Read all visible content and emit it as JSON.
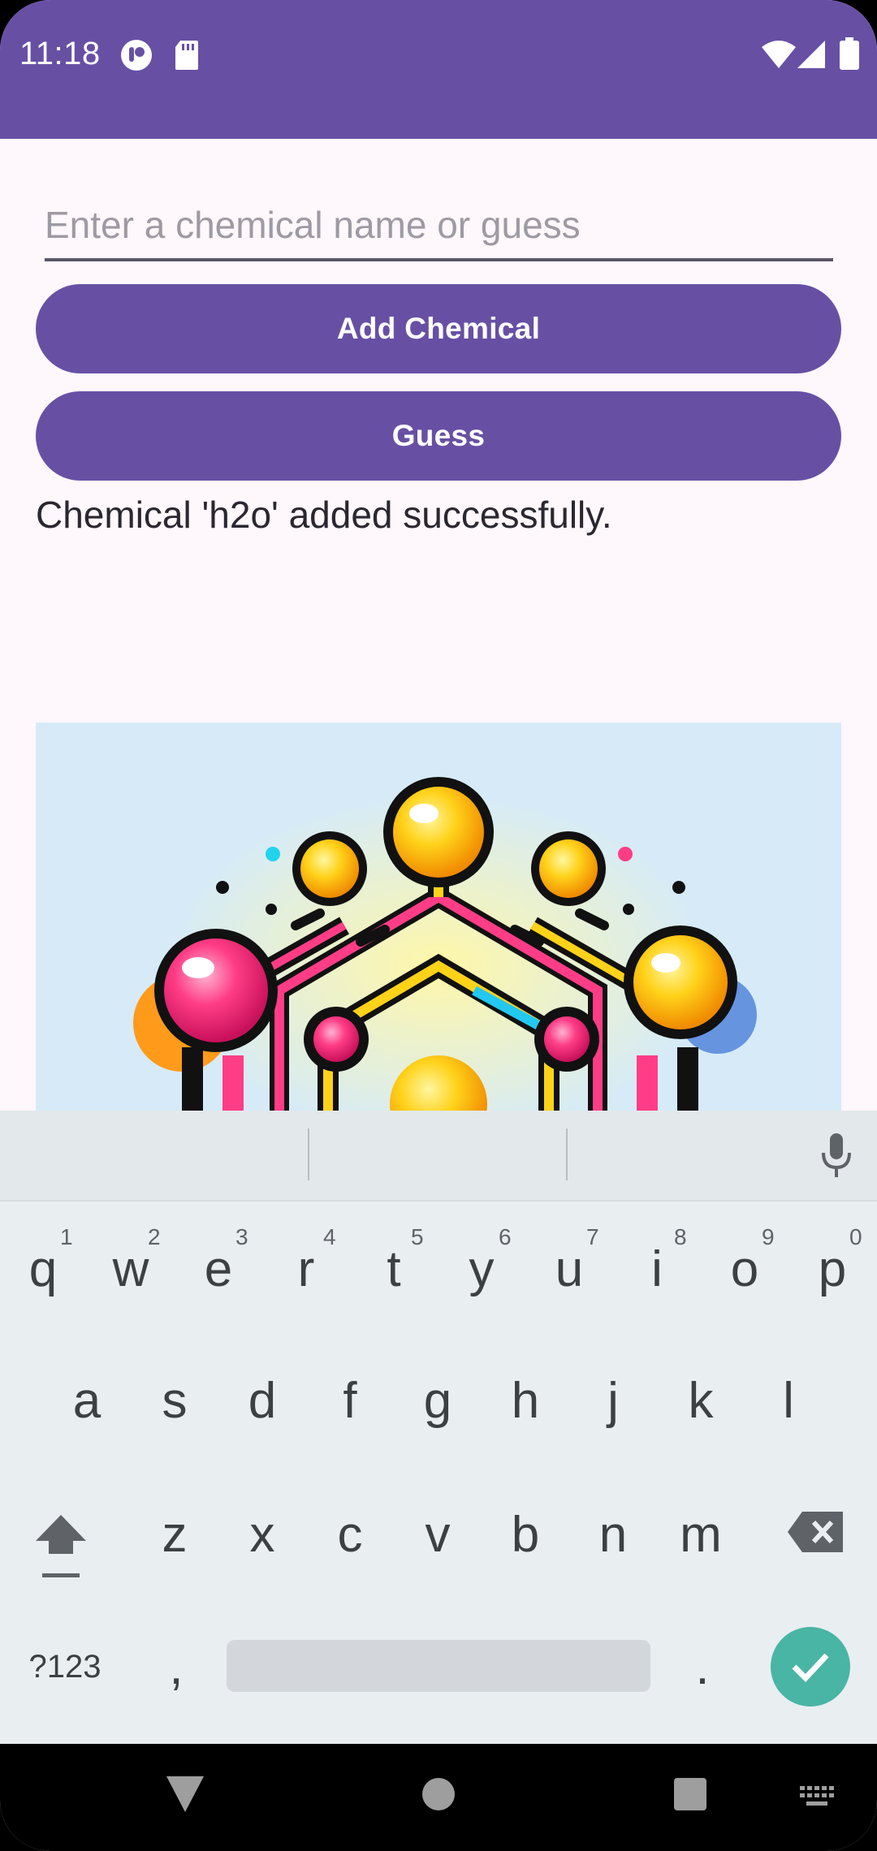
{
  "status_bar": {
    "time": "11:18"
  },
  "input": {
    "placeholder": "Enter a chemical name or guess",
    "value": ""
  },
  "buttons": {
    "add_label": "Add Chemical",
    "guess_label": "Guess"
  },
  "message": "Chemical 'h2o' added successfully.",
  "image": {
    "description_icon": "molecule-illustration"
  },
  "keyboard": {
    "row1": [
      "q",
      "w",
      "e",
      "r",
      "t",
      "y",
      "u",
      "i",
      "o",
      "p"
    ],
    "row1_hints": [
      "1",
      "2",
      "3",
      "4",
      "5",
      "6",
      "7",
      "8",
      "9",
      "0"
    ],
    "row2": [
      "a",
      "s",
      "d",
      "f",
      "g",
      "h",
      "j",
      "k",
      "l"
    ],
    "row3": [
      "z",
      "x",
      "c",
      "v",
      "b",
      "n",
      "m"
    ],
    "symbols_label": "?123",
    "comma": ",",
    "period": "."
  },
  "colors": {
    "primary": "#6750a4",
    "background": "#fef7fb",
    "keyboard_bg": "#e9eef1",
    "enter_key": "#49b5a4"
  }
}
